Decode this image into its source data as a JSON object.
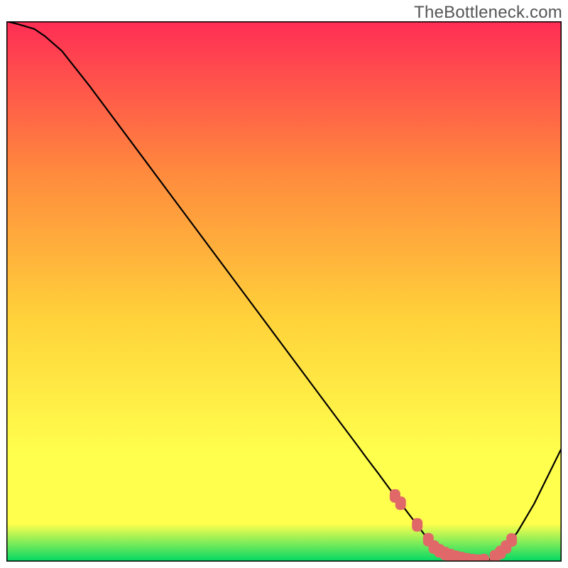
{
  "watermark": "TheBottleneck.com",
  "colors": {
    "gradient_top": "#ff2d55",
    "gradient_upper_mid": "#ff8a3d",
    "gradient_mid": "#ffd23a",
    "gradient_low_mid": "#ffff4d",
    "gradient_bottom": "#00d865",
    "curve": "#000000",
    "marker": "#e06868",
    "marker_stroke": "#e06868",
    "frame": "#000000",
    "bg": "#ffffff"
  },
  "chart_data": {
    "type": "line",
    "title": "",
    "xlabel": "",
    "ylabel": "",
    "xlim": [
      0,
      100
    ],
    "ylim": [
      0,
      100
    ],
    "grid": false,
    "legend": false,
    "series": [
      {
        "name": "bottleneck-curve",
        "x": [
          0,
          2,
          5,
          7,
          10,
          15,
          20,
          25,
          30,
          35,
          40,
          45,
          50,
          55,
          60,
          63,
          65,
          67,
          69,
          70,
          71,
          72,
          73,
          74,
          75,
          76,
          77,
          78,
          79,
          80,
          81,
          82,
          83,
          84,
          85,
          86,
          87,
          88,
          89,
          90,
          92,
          95,
          100
        ],
        "y": [
          100,
          99.5,
          98.6,
          97.2,
          94.5,
          88.0,
          81.1,
          74.2,
          67.3,
          60.4,
          53.5,
          46.6,
          39.7,
          32.8,
          25.9,
          21.8,
          19.0,
          16.3,
          13.5,
          12.15,
          10.8,
          9.45,
          8.1,
          6.8,
          5.4,
          4.05,
          2.7,
          2.0,
          1.5,
          1.1,
          0.8,
          0.55,
          0.35,
          0.2,
          0.1,
          0.2,
          0.4,
          0.9,
          1.7,
          2.7,
          5.4,
          10.6,
          21.0
        ]
      }
    ],
    "markers": {
      "name": "highlight-points",
      "x": [
        70,
        71,
        74,
        76,
        77,
        78,
        79,
        80,
        81,
        82,
        83,
        84,
        85,
        86,
        88,
        89,
        90,
        91
      ],
      "y": [
        12.15,
        10.8,
        6.8,
        4.05,
        2.7,
        2.0,
        1.5,
        1.1,
        0.8,
        0.55,
        0.35,
        0.2,
        0.1,
        0.2,
        0.9,
        1.7,
        2.7,
        4.0
      ]
    }
  }
}
